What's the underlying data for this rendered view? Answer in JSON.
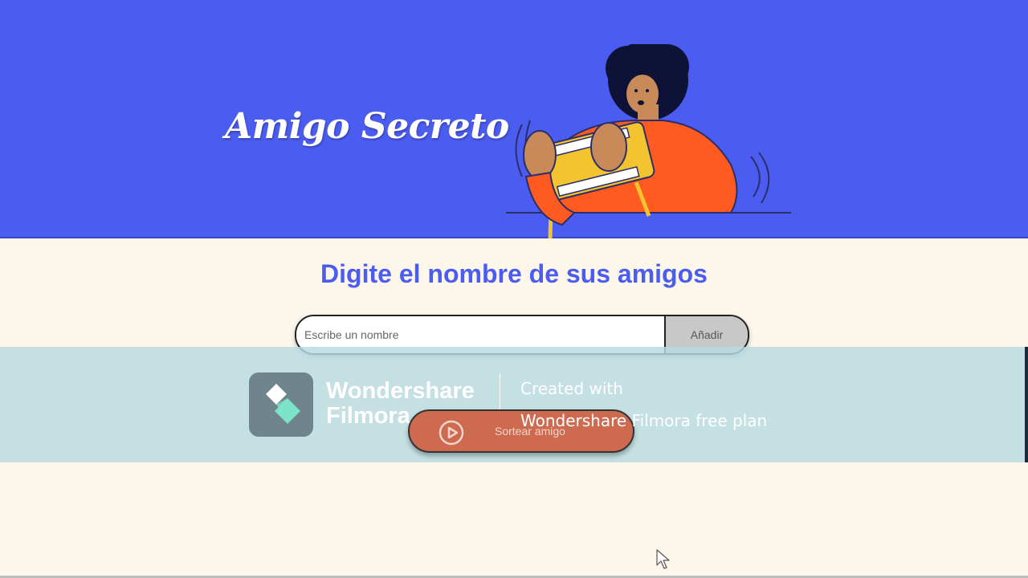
{
  "header": {
    "title": "Amigo Secreto",
    "background": "#4b5cf0",
    "illustration": "person-playing-handheld-console"
  },
  "main": {
    "heading": "Digite el nombre de sus amigos",
    "input": {
      "placeholder": "Escribe un nombre",
      "value": ""
    },
    "add_button_label": "Añadir",
    "draw_button": {
      "label": "Sortear amigo",
      "icon": "play-circle-icon",
      "color": "#cd6a50"
    },
    "background": "#fdf6ea"
  },
  "watermark": {
    "brand_line1": "Wondershare",
    "brand_line2": "Filmora",
    "created_line1": "Created with",
    "created_line2": "Wondershare Filmora free plan",
    "logo_icon": "filmora-logo-icon"
  }
}
